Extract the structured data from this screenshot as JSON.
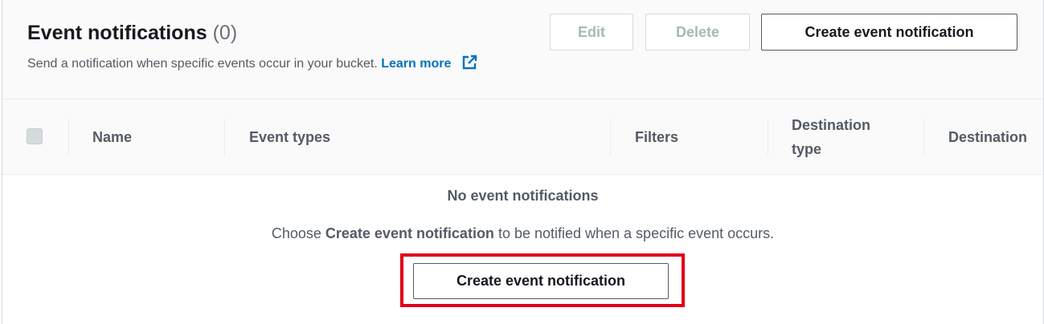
{
  "header": {
    "title": "Event notifications",
    "count": "(0)",
    "description": "Send a notification when specific events occur in your bucket.",
    "learn_more": "Learn more",
    "buttons": {
      "edit": "Edit",
      "delete": "Delete",
      "create": "Create event notification"
    }
  },
  "table": {
    "columns": [
      "Name",
      "Event types",
      "Filters",
      "Destination type",
      "Destination"
    ]
  },
  "empty_state": {
    "title": "No event notifications",
    "desc_prefix": "Choose ",
    "desc_bold": "Create event notification",
    "desc_suffix": " to be notified when a specific event occurs.",
    "button": "Create event notification"
  },
  "colors": {
    "link": "#0073bb",
    "highlight": "#e0001b"
  },
  "icons": {
    "learn_more": "external-link-icon"
  }
}
